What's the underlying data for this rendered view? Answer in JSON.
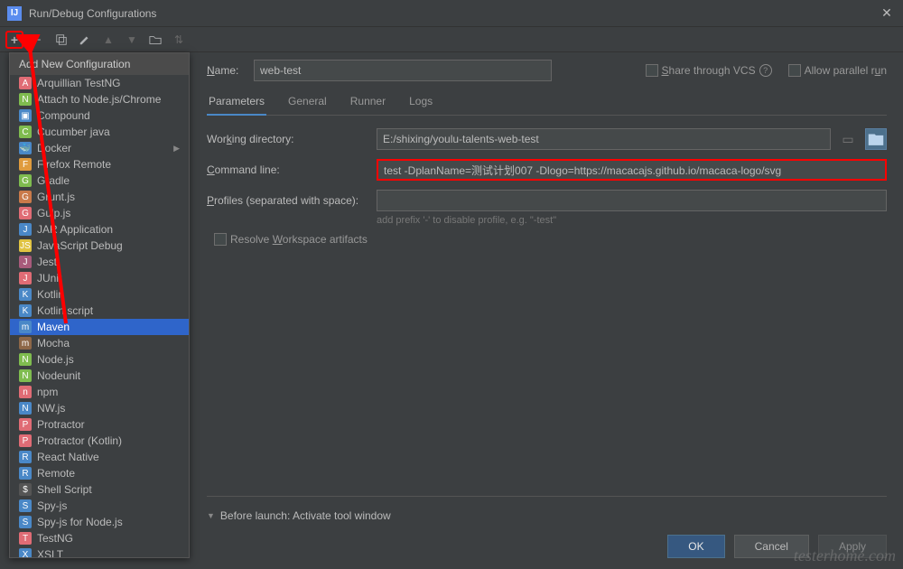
{
  "title": "Run/Debug Configurations",
  "name_label": "Name:",
  "name_value": "web-test",
  "share_label": "Share through VCS",
  "parallel_label": "Allow parallel run",
  "popup_header": "Add New Configuration",
  "config_types": [
    {
      "label": "Arquillian TestNG",
      "icon": "A",
      "bg": "#e06c75"
    },
    {
      "label": "Attach to Node.js/Chrome",
      "icon": "N",
      "bg": "#7fbc4f"
    },
    {
      "label": "Compound",
      "icon": "▣",
      "bg": "#4a88c7"
    },
    {
      "label": "Cucumber java",
      "icon": "C",
      "bg": "#7fbc4f"
    },
    {
      "label": "Docker",
      "icon": "🐳",
      "bg": "#4a88c7",
      "sub": true
    },
    {
      "label": "Firefox Remote",
      "icon": "F",
      "bg": "#e09b3d"
    },
    {
      "label": "Gradle",
      "icon": "G",
      "bg": "#7fbc4f"
    },
    {
      "label": "Grunt.js",
      "icon": "G",
      "bg": "#c97a4a"
    },
    {
      "label": "Gulp.js",
      "icon": "G",
      "bg": "#e06c75"
    },
    {
      "label": "JAR Application",
      "icon": "J",
      "bg": "#4a88c7"
    },
    {
      "label": "JavaScript Debug",
      "icon": "JS",
      "bg": "#e0c341"
    },
    {
      "label": "Jest",
      "icon": "J",
      "bg": "#a85b7b"
    },
    {
      "label": "JUnit",
      "icon": "J",
      "bg": "#e06c75"
    },
    {
      "label": "Kotlin",
      "icon": "K",
      "bg": "#4a88c7"
    },
    {
      "label": "Kotlin script",
      "icon": "K",
      "bg": "#4a88c7"
    },
    {
      "label": "Maven",
      "icon": "m",
      "bg": "#4a88c7",
      "selected": true
    },
    {
      "label": "Mocha",
      "icon": "m",
      "bg": "#8d6748"
    },
    {
      "label": "Node.js",
      "icon": "N",
      "bg": "#7fbc4f"
    },
    {
      "label": "Nodeunit",
      "icon": "N",
      "bg": "#7fbc4f"
    },
    {
      "label": "npm",
      "icon": "n",
      "bg": "#e06c75"
    },
    {
      "label": "NW.js",
      "icon": "N",
      "bg": "#4a88c7"
    },
    {
      "label": "Protractor",
      "icon": "P",
      "bg": "#e06c75"
    },
    {
      "label": "Protractor (Kotlin)",
      "icon": "P",
      "bg": "#e06c75"
    },
    {
      "label": "React Native",
      "icon": "R",
      "bg": "#4a88c7"
    },
    {
      "label": "Remote",
      "icon": "R",
      "bg": "#4a88c7"
    },
    {
      "label": "Shell Script",
      "icon": "$",
      "bg": "#555"
    },
    {
      "label": "Spy-js",
      "icon": "S",
      "bg": "#4a88c7"
    },
    {
      "label": "Spy-js for Node.js",
      "icon": "S",
      "bg": "#4a88c7"
    },
    {
      "label": "TestNG",
      "icon": "T",
      "bg": "#e06c75"
    },
    {
      "label": "XSLT",
      "icon": "X",
      "bg": "#4a88c7"
    }
  ],
  "tabs": [
    {
      "label": "Parameters",
      "active": true
    },
    {
      "label": "General"
    },
    {
      "label": "Runner"
    },
    {
      "label": "Logs"
    }
  ],
  "form": {
    "working_dir_label": "Working directory:",
    "working_dir_value": "E:/shixing/youlu-talents-web-test",
    "cmd_label": "Command line:",
    "cmd_value": "test -DplanName=测试计划007 -Dlogo=https://macacajs.github.io/macaca-logo/svg",
    "profiles_label": "Profiles (separated with space):",
    "profiles_value": "",
    "profiles_hint": "add prefix '-' to disable profile, e.g. \"-test\"",
    "resolve_label": "Resolve Workspace artifacts"
  },
  "before_launch": "Before launch: Activate tool window",
  "buttons": {
    "ok": "OK",
    "cancel": "Cancel",
    "apply": "Apply"
  },
  "watermark": "testerhome.com"
}
